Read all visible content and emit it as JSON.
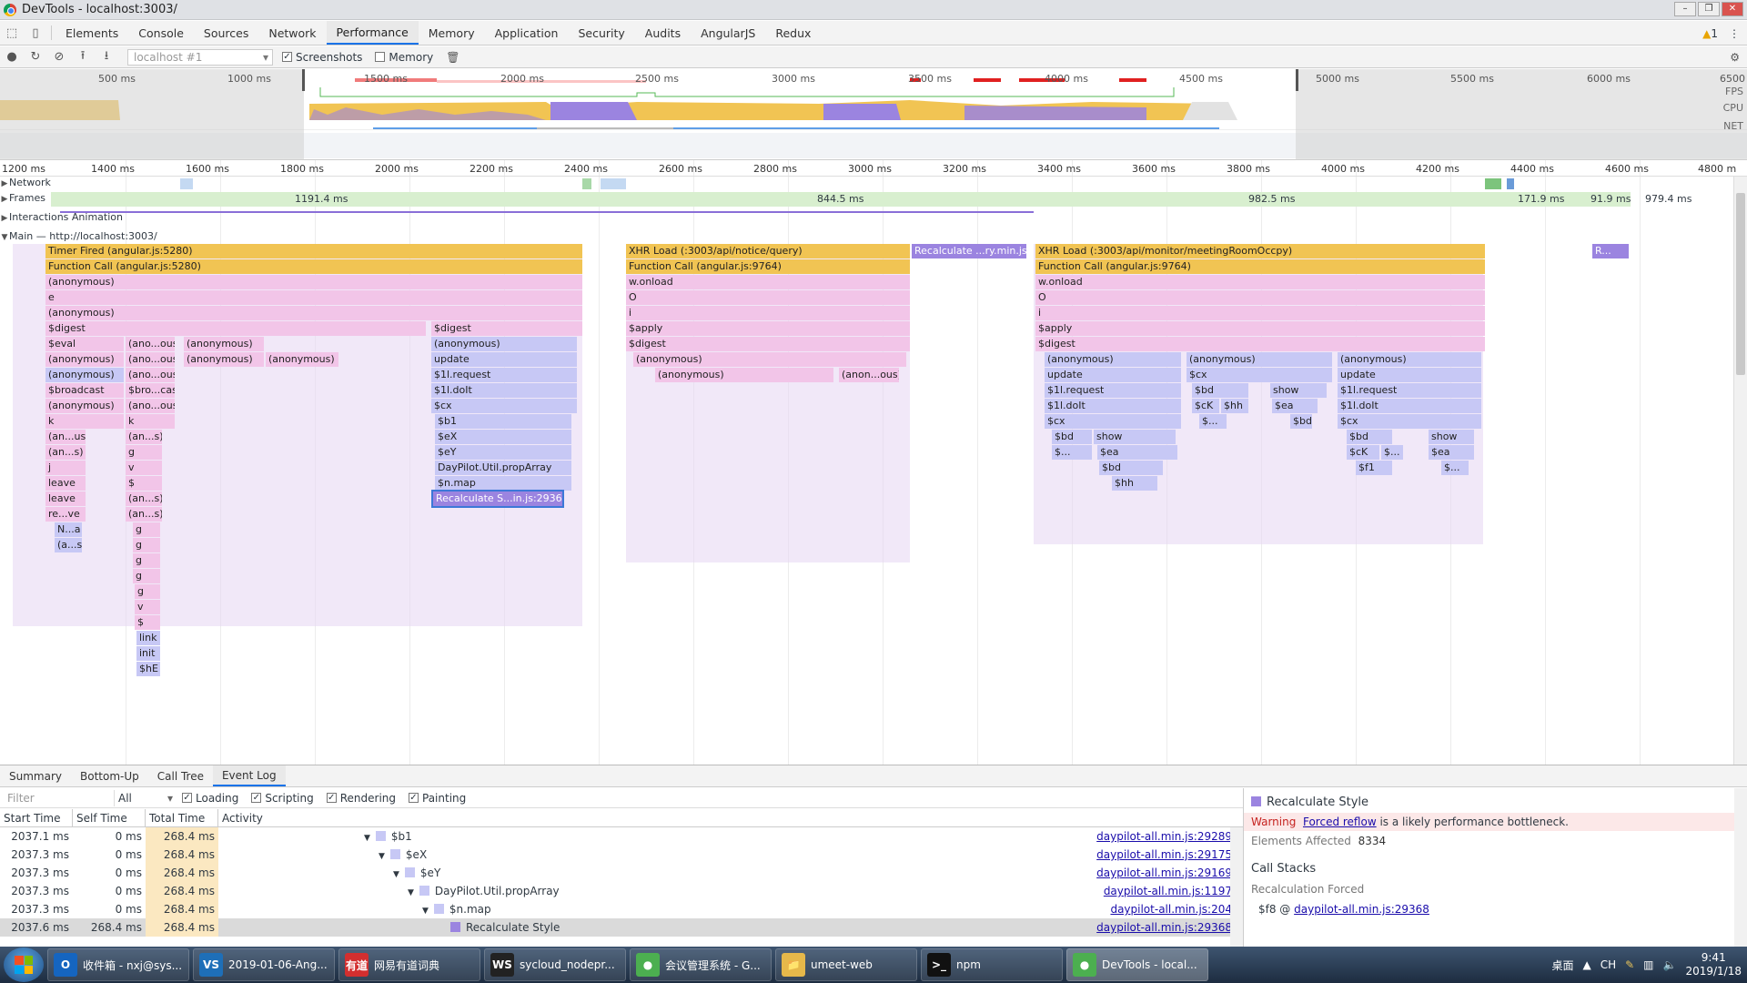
{
  "window": {
    "title": "DevTools - localhost:3003/"
  },
  "tabs": [
    "Elements",
    "Console",
    "Sources",
    "Network",
    "Performance",
    "Memory",
    "Application",
    "Security",
    "Audits",
    "AngularJS",
    "Redux"
  ],
  "active_tab": "Performance",
  "warnings_count": "1",
  "perf_toolbar": {
    "profile_select": "localhost #1",
    "screenshots_label": "Screenshots",
    "memory_label": "Memory"
  },
  "overview": {
    "ticks": [
      "500 ms",
      "1000 ms",
      "1500 ms",
      "2000 ms",
      "2500 ms",
      "3000 ms",
      "3500 ms",
      "4000 ms",
      "4500 ms",
      "5000 ms",
      "5500 ms",
      "6000 ms",
      "6500"
    ],
    "labels": [
      "FPS",
      "CPU",
      "NET"
    ]
  },
  "ruler": [
    "1200 ms",
    "1400 ms",
    "1600 ms",
    "1800 ms",
    "2000 ms",
    "2200 ms",
    "2400 ms",
    "2600 ms",
    "2800 ms",
    "3000 ms",
    "3200 ms",
    "3400 ms",
    "3600 ms",
    "3800 ms",
    "4000 ms",
    "4200 ms",
    "4400 ms",
    "4600 ms",
    "4800 m"
  ],
  "tracks": {
    "network": "Network",
    "frames": "Frames",
    "interactions": "Interactions Animation",
    "main": "Main — http://localhost:3003/",
    "frame_times": [
      "1191.4 ms",
      "844.5 ms",
      "982.5 ms",
      "171.9 ms",
      "91.9 ms",
      "979.4 ms"
    ]
  },
  "flame": {
    "col1": [
      "Timer Fired (angular.js:5280)",
      "Function Call (angular.js:5280)",
      "(anonymous)",
      "e",
      "(anonymous)",
      "$digest",
      "$eval",
      "(anonymous)",
      "(anonymous)",
      "$broadcast",
      "(anonymous)",
      "k",
      "(an...us)",
      "(an...s)",
      "j",
      "leave",
      "leave",
      "re...ve",
      "N...a",
      "(a...s)"
    ],
    "col2": [
      "(ano...ous)",
      "(ano...ous)",
      "(ano...ous)",
      "$bro...cast",
      "(ano...ous)",
      "k",
      "(an...s)",
      "g",
      "v",
      "$",
      "(an...s)",
      "(an...s)",
      "g",
      "g",
      "g",
      "g",
      "g",
      "v",
      "$",
      "link",
      "init",
      "$hE"
    ],
    "col3": [
      "(anonymous)",
      "(anonymous)",
      "(anonymous)"
    ],
    "col4": [
      "$digest",
      "(anonymous)",
      "update",
      "$1l.request",
      "$1l.doIt",
      "$cx",
      "$b1",
      "$eX",
      "$eY",
      "DayPilot.Util.propArray",
      "$n.map",
      "Recalculate S...in.js:29368)"
    ],
    "col5": [
      "XHR Load (:3003/api/notice/query)",
      "Function Call (angular.js:9764)",
      "w.onload",
      "O",
      "i",
      "$apply",
      "$digest",
      "(anonymous)",
      "(anonymous)",
      "(anon...ous)"
    ],
    "recalc": "Recalculate ...ry.min.js:3)",
    "col6": [
      "XHR Load (:3003/api/monitor/meetingRoomOccpy)",
      "Function Call (angular.js:9764)",
      "w.onload",
      "O",
      "i",
      "$apply",
      "$digest"
    ],
    "col6b": [
      "(anonymous)",
      "update",
      "$1l.request",
      "$1l.doIt",
      "$cx",
      "$bd",
      "$...",
      "$bd",
      "$hh"
    ],
    "col6b2": [
      "show",
      "$ea"
    ],
    "col7": [
      "(anonymous)",
      "$cx",
      "$bd",
      "$cK",
      "$hh",
      "$...",
      "$ea"
    ],
    "col7b": [
      "show",
      "$ea",
      "$bd"
    ],
    "col8": [
      "(anonymous)",
      "update",
      "$1l.request",
      "$1l.doIt",
      "$cx",
      "$bd",
      "$cK",
      "$...",
      "$f1"
    ],
    "col8b": [
      "show",
      "$ea",
      "$..."
    ],
    "tail": "R..."
  },
  "bottom": {
    "tabs": [
      "Summary",
      "Bottom-Up",
      "Call Tree",
      "Event Log"
    ],
    "active": "Event Log",
    "filter_placeholder": "Filter",
    "all": "All",
    "checks": [
      "Loading",
      "Scripting",
      "Rendering",
      "Painting"
    ],
    "columns": [
      "Start Time",
      "Self Time",
      "Total Time",
      "Activity"
    ],
    "rows": [
      {
        "start": "2037.1 ms",
        "self": "0 ms",
        "total": "268.4 ms",
        "activity": "$b1",
        "link": "daypilot-all.min.js:29289",
        "color": "#c7c8f5"
      },
      {
        "start": "2037.3 ms",
        "self": "0 ms",
        "total": "268.4 ms",
        "activity": "$eX",
        "link": "daypilot-all.min.js:29175",
        "color": "#c7c8f5"
      },
      {
        "start": "2037.3 ms",
        "self": "0 ms",
        "total": "268.4 ms",
        "activity": "$eY",
        "link": "daypilot-all.min.js:29169",
        "color": "#c7c8f5"
      },
      {
        "start": "2037.3 ms",
        "self": "0 ms",
        "total": "268.4 ms",
        "activity": "DayPilot.Util.propArray",
        "link": "daypilot-all.min.js:1197",
        "color": "#c7c8f5"
      },
      {
        "start": "2037.3 ms",
        "self": "0 ms",
        "total": "268.4 ms",
        "activity": "$n.map",
        "link": "daypilot-all.min.js:204",
        "color": "#c7c8f5"
      },
      {
        "start": "2037.6 ms",
        "self": "268.4 ms",
        "total": "268.4 ms",
        "activity": "Recalculate Style",
        "link": "daypilot-all.min.js:29368",
        "color": "#9b84e0"
      }
    ]
  },
  "detail": {
    "title": "Recalculate Style",
    "warning_label": "Warning",
    "warning_link": "Forced reflow",
    "warning_text": " is a likely performance bottleneck.",
    "elements_label": "Elements Affected",
    "elements_value": "8334",
    "call_stacks": "Call Stacks",
    "recalc_forced": "Recalculation Forced",
    "stack_fn": "$f8 @ ",
    "stack_link": "daypilot-all.min.js:29368"
  },
  "taskbar": {
    "items": [
      {
        "label": "收件箱 - nxj@sys...",
        "icon": "O",
        "color": "#1565c0"
      },
      {
        "label": "2019-01-06-Ang...",
        "icon": "VS",
        "color": "#1e6fb8"
      },
      {
        "label": "网易有道词典",
        "icon": "有道",
        "color": "#d32f2f"
      },
      {
        "label": "sycloud_nodepr...",
        "icon": "WS",
        "color": "#222"
      },
      {
        "label": "会议管理系统 - G...",
        "icon": "●",
        "color": "#4caf50"
      },
      {
        "label": "umeet-web",
        "icon": "📁",
        "color": "#e6b84a"
      },
      {
        "label": "npm",
        "icon": ">_",
        "color": "#111"
      },
      {
        "label": "DevTools - local...",
        "icon": "●",
        "color": "#4caf50"
      }
    ],
    "tray_label": "桌面",
    "lang": "CH",
    "time": "9:41",
    "date": "2019/1/18"
  }
}
